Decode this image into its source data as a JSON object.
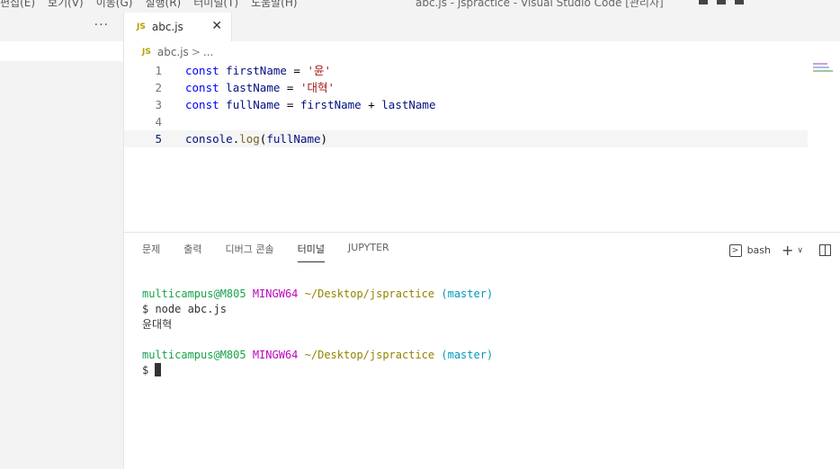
{
  "titlebar": {
    "menu": [
      "편집(E)",
      "보기(V)",
      "이동(G)",
      "실행(R)",
      "터미널(T)",
      "도움말(H)"
    ],
    "title": "abc.js - jspractice - Visual Studio Code [관리자]"
  },
  "sidebar": {
    "more": "···"
  },
  "tab": {
    "badge": "JS",
    "name": "abc.js",
    "close": "✕"
  },
  "breadcrumb": {
    "badge": "JS",
    "file": "abc.js",
    "sep": ">",
    "rest": "..."
  },
  "editor": {
    "lines": [
      {
        "num": "1",
        "tokens": [
          [
            "kw",
            "const"
          ],
          [
            "op",
            " "
          ],
          [
            "var",
            "firstName"
          ],
          [
            "op",
            " = "
          ],
          [
            "str",
            "'윤'"
          ]
        ]
      },
      {
        "num": "2",
        "tokens": [
          [
            "kw",
            "const"
          ],
          [
            "op",
            " "
          ],
          [
            "var",
            "lastName"
          ],
          [
            "op",
            " = "
          ],
          [
            "str",
            "'대혁'"
          ]
        ]
      },
      {
        "num": "3",
        "tokens": [
          [
            "kw",
            "const"
          ],
          [
            "op",
            " "
          ],
          [
            "var",
            "fullName"
          ],
          [
            "op",
            " = "
          ],
          [
            "var",
            "firstName"
          ],
          [
            "op",
            " + "
          ],
          [
            "var",
            "lastName"
          ]
        ]
      },
      {
        "num": "4",
        "tokens": []
      },
      {
        "num": "5",
        "tokens": [
          [
            "var",
            "console"
          ],
          [
            "op",
            "."
          ],
          [
            "fn",
            "log"
          ],
          [
            "op",
            "("
          ],
          [
            "var",
            "fullName"
          ],
          [
            "op",
            ")"
          ]
        ]
      }
    ]
  },
  "panel": {
    "tabs": [
      "문제",
      "출력",
      "디버그 콘솔",
      "터미널",
      "JUPYTER"
    ],
    "active_tab": "터미널",
    "shell": "bash",
    "plus": "+",
    "chevron": "∨"
  },
  "terminal": {
    "prompt1": {
      "user": "multicampus@M805",
      "env": "MINGW64",
      "path": "~/Desktop/jspractice",
      "branch": "(master)"
    },
    "cmd": "$ node abc.js",
    "output": "윤대혁",
    "prompt2": {
      "user": "multicampus@M805",
      "env": "MINGW64",
      "path": "~/Desktop/jspractice",
      "branch": "(master)"
    },
    "dollar": "$ "
  },
  "colors": {
    "keyword": "#0000ff",
    "variable": "#001080",
    "string": "#a31515",
    "function": "#795e26",
    "term_user": "#16a34a",
    "term_env": "#bc05bc",
    "term_path": "#948300",
    "term_branch": "#0598bc"
  }
}
